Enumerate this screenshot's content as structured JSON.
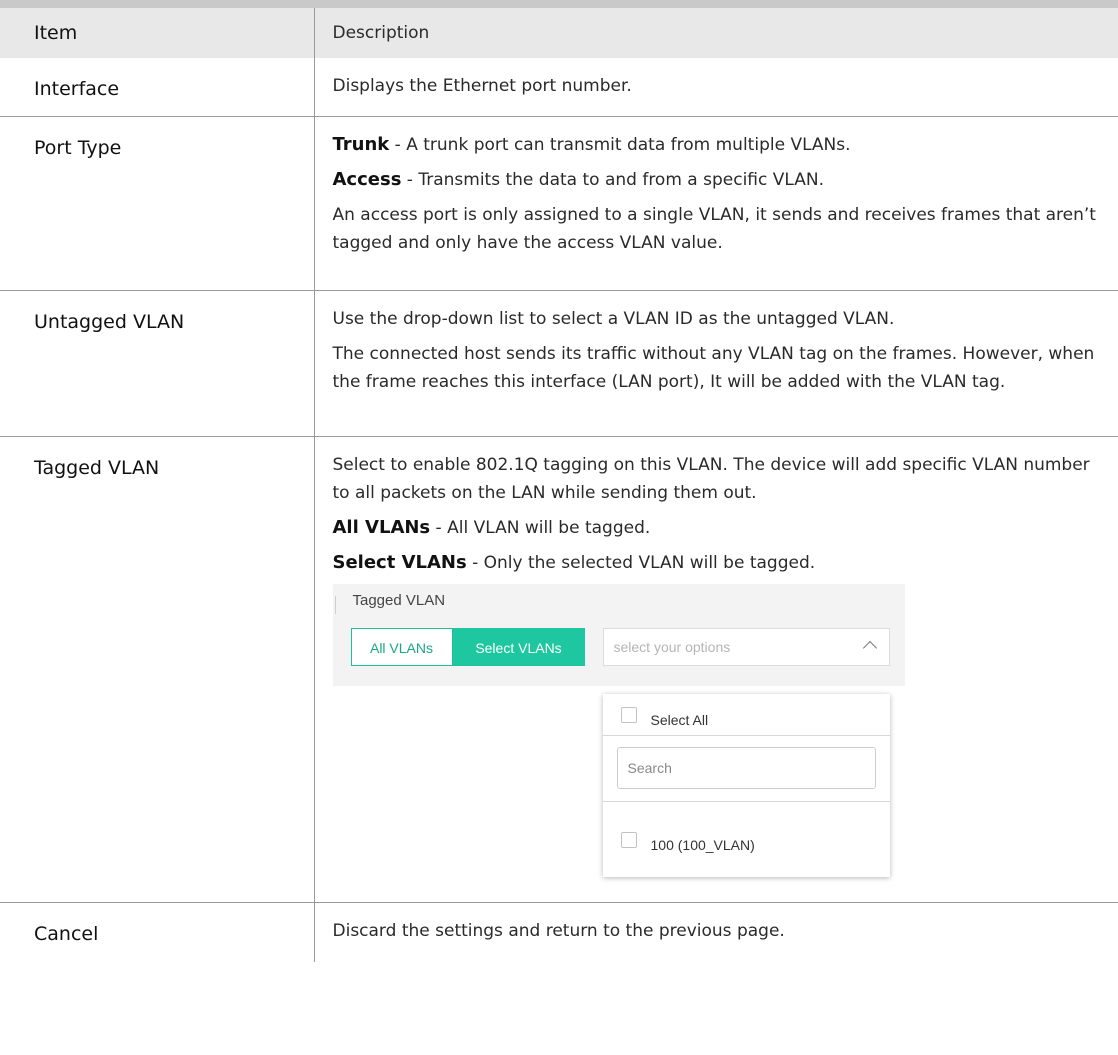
{
  "table": {
    "header": {
      "item": "Item",
      "description": "Description"
    },
    "rows": [
      {
        "item": "Interface",
        "paras": [
          {
            "term": "",
            "text": "Displays the Ethernet port number."
          }
        ]
      },
      {
        "item": "Port Type",
        "paras": [
          {
            "term": "Trunk",
            "text": " - A trunk port can transmit data from multiple VLANs."
          },
          {
            "term": "Access",
            "text": " - Transmits the data to and from a specific VLAN."
          },
          {
            "term": "",
            "text": "An access port is only assigned to a single VLAN, it sends and receives frames that aren’t tagged and only have the access VLAN value."
          }
        ]
      },
      {
        "item": "Untagged VLAN",
        "paras": [
          {
            "term": "",
            "text": "Use the drop-down list to select a VLAN ID as the untagged VLAN."
          },
          {
            "term": "",
            "text": "The connected host sends its traffic without any VLAN tag on the frames. However, when the frame reaches this interface (LAN port), It will be added with the VLAN tag."
          }
        ]
      },
      {
        "item": "Tagged VLAN",
        "paras": [
          {
            "term": "",
            "text": "Select to enable 802.1Q tagging on this VLAN. The device will add specific VLAN number to all packets on the LAN while sending them out."
          },
          {
            "term": "All VLANs",
            "text": " - All VLAN will be tagged."
          },
          {
            "term": "Select VLANs",
            "text": " - Only the selected VLAN will be tagged."
          }
        ]
      },
      {
        "item": "Cancel",
        "paras": [
          {
            "term": "",
            "text": "Discard the settings and return to the previous page."
          }
        ]
      }
    ]
  },
  "screenshot": {
    "label": "Tagged VLAN",
    "all_vlans_label": "All VLANs",
    "select_vlans_label": "Select VLANs",
    "select_placeholder": "select your options",
    "select_all_label": "Select All",
    "search_placeholder": "Search",
    "option_label": "100 (100_VLAN)",
    "accent_color": "#1ec79f"
  }
}
